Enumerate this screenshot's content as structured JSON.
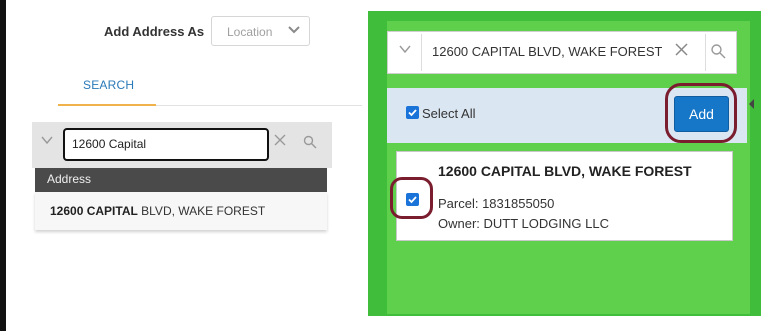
{
  "add_address": {
    "label": "Add Address As",
    "select_value": "Location"
  },
  "tabs": [
    {
      "label": "SEARCH"
    }
  ],
  "left_search": {
    "value": "12600 Capital"
  },
  "suggestions": {
    "header": "Address",
    "items": [
      {
        "bold": "12600 CAPITAL",
        "rest": " BLVD, WAKE FOREST"
      }
    ]
  },
  "right_search": {
    "value": "12600 CAPITAL BLVD, WAKE FOREST"
  },
  "selection": {
    "select_all_label": "Select All",
    "add_label": "Add"
  },
  "result": {
    "title": "12600 CAPITAL BLVD, WAKE FOREST",
    "parcel": "Parcel: 1831855050",
    "owner": "Owner: DUTT LODGING LLC"
  },
  "colors": {
    "accent": "#1676c8",
    "green": "#3fbd3b",
    "highlight_ring": "#7a1d2e",
    "tab_underline": "#f0b34b"
  },
  "icons": [
    "chevron-down-icon",
    "close-icon",
    "search-icon",
    "checkbox-checked-icon",
    "chevron-left-icon"
  ]
}
